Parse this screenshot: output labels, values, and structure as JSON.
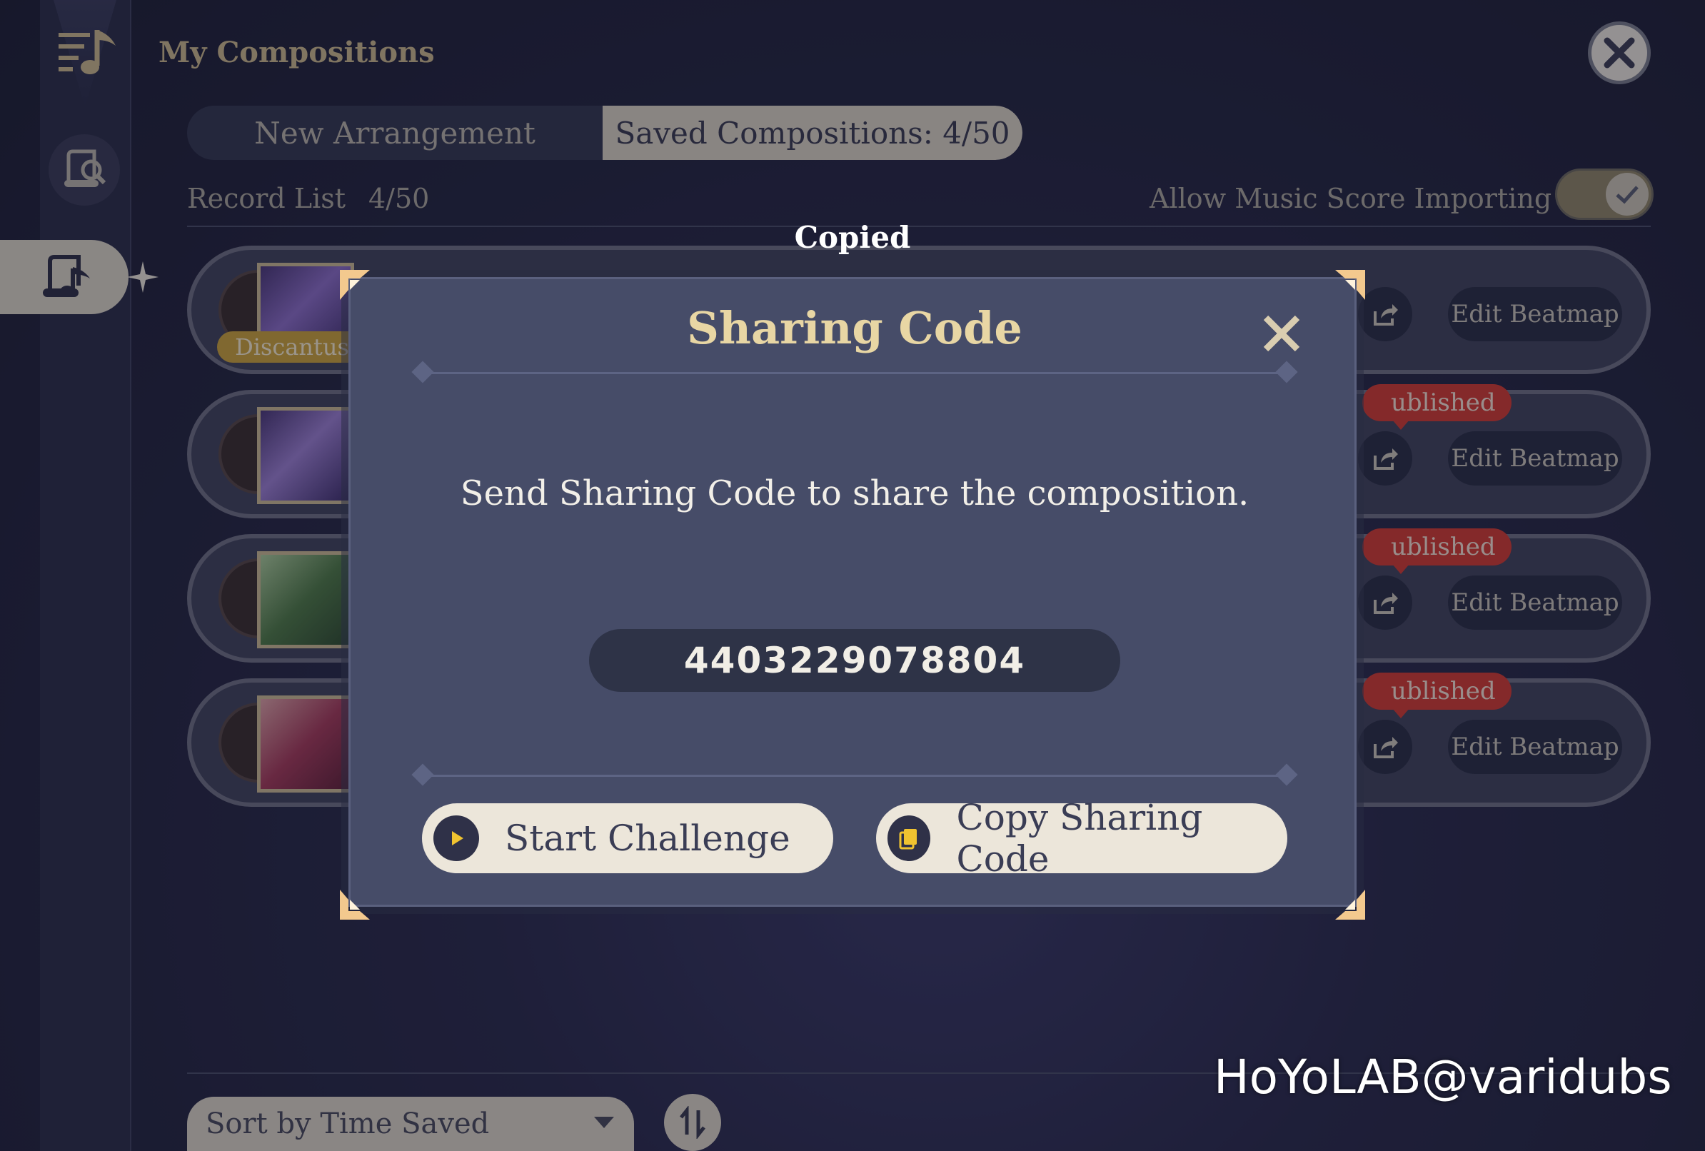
{
  "header": {
    "title": "My Compositions"
  },
  "tabs": {
    "new_label": "New Arrangement",
    "saved_label": "Saved Compositions: 4/50"
  },
  "list": {
    "record_label": "Record List",
    "record_count": "4/50",
    "allow_label": "Allow Music Score Importing",
    "allow_enabled": true
  },
  "rows": [
    {
      "badge": "Discantus",
      "edit_label": "Edit Beatmap",
      "published": ""
    },
    {
      "badge": "",
      "edit_label": "Edit Beatmap",
      "published": "ublished"
    },
    {
      "badge": "",
      "edit_label": "Edit Beatmap",
      "published": "ublished"
    },
    {
      "badge": "",
      "edit_label": "Edit Beatmap",
      "published": "ublished"
    }
  ],
  "toast": "Copied",
  "modal": {
    "title": "Sharing Code",
    "message": "Send Sharing Code to share the composition.",
    "code": "4403229078804",
    "start_label": "Start Challenge",
    "copy_label": "Copy Sharing Code"
  },
  "footer": {
    "sort_label": "Sort by Time Saved"
  },
  "watermark": "HoYoLAB@varidubs",
  "icons": {
    "menu": "music-list-icon",
    "search": "score-search-icon",
    "active": "score-icon",
    "close": "close-icon",
    "share": "share-icon",
    "play": "play-icon",
    "copy": "copy-icon",
    "sort": "sort-icon"
  },
  "colors": {
    "accent_gold": "#c9b78d",
    "badge_red": "#cf3c34",
    "panel": "#464c68"
  }
}
